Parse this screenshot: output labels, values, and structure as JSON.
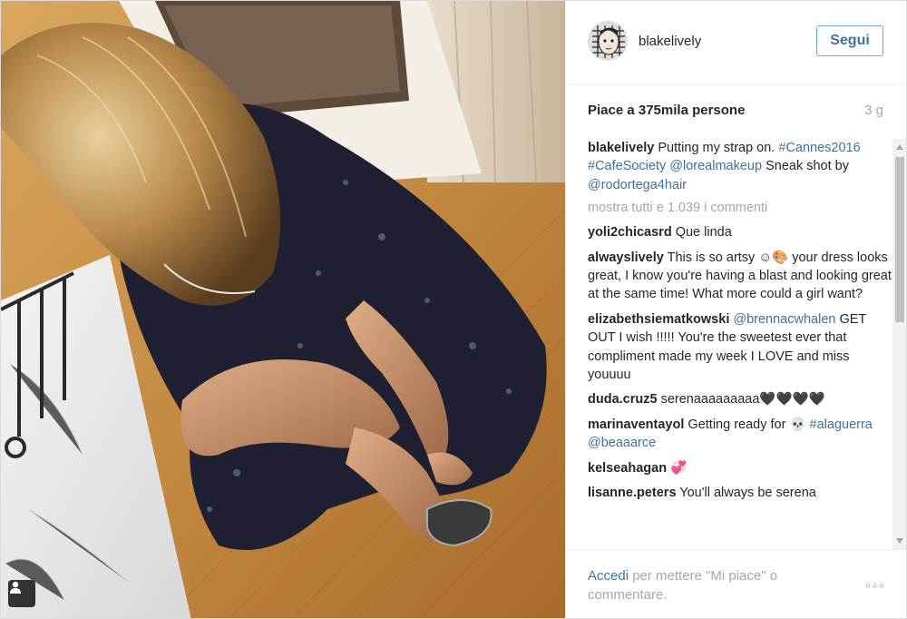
{
  "post": {
    "username": "blakelively",
    "follow_label": "Segui",
    "likes": "Piace a 375mila persone",
    "time": "3 g",
    "show_all": "mostra tutti e 1.039 i commenti",
    "caption": {
      "user": "blakelively",
      "parts": [
        {
          "text": " Putting my strap on. ",
          "tag": false
        },
        {
          "text": "#Cannes2016",
          "tag": true
        },
        {
          "text": " ",
          "tag": false
        },
        {
          "text": "#CafeSociety",
          "tag": true
        },
        {
          "text": " ",
          "tag": false
        },
        {
          "text": "@lorealmakeup",
          "tag": true
        },
        {
          "text": " Sneak shot by ",
          "tag": false
        },
        {
          "text": "@rodortega4hair",
          "tag": true
        }
      ]
    },
    "comments": [
      {
        "user": "yoli2chicasrd",
        "parts": [
          {
            "text": " Que linda",
            "tag": false
          }
        ]
      },
      {
        "user": "alwayslively",
        "parts": [
          {
            "text": " This is so artsy ☺🎨 your dress looks great, I know you're having a blast and looking great at the same time! What more could a girl want?",
            "tag": false
          }
        ]
      },
      {
        "user": "elizabethsiematkowski",
        "parts": [
          {
            "text": " ",
            "tag": false
          },
          {
            "text": "@brennacwhalen",
            "tag": true
          },
          {
            "text": " GET OUT I wish !!!!! You're the sweetest ever that compliment made my week I LOVE and miss youuuu",
            "tag": false
          }
        ]
      },
      {
        "user": "duda.cruz5",
        "parts": [
          {
            "text": " serenaaaaaaaaa🖤🖤🖤🖤",
            "tag": false
          }
        ]
      },
      {
        "user": "marinaventayol",
        "parts": [
          {
            "text": " Getting ready for 💀 ",
            "tag": false
          },
          {
            "text": "#alaguerra",
            "tag": true
          },
          {
            "text": " ",
            "tag": false
          },
          {
            "text": "@beaaarce",
            "tag": true
          }
        ]
      },
      {
        "user": "kelseahagan",
        "parts": [
          {
            "text": " 💞",
            "tag": false
          }
        ]
      },
      {
        "user": "lisanne.peters",
        "parts": [
          {
            "text": " You'll always be serena",
            "tag": false
          }
        ]
      }
    ],
    "footer": {
      "login_link": "Accedi",
      "login_rest": " per mettere \"Mi piace\" o commentare.",
      "more_icon": "ellipsis-icon",
      "more_label": "◦◦◦"
    }
  },
  "colors": {
    "link": "#3f729b",
    "muted": "#a5a7aa",
    "text": "#262626",
    "follow_border": "#70a6e1"
  }
}
